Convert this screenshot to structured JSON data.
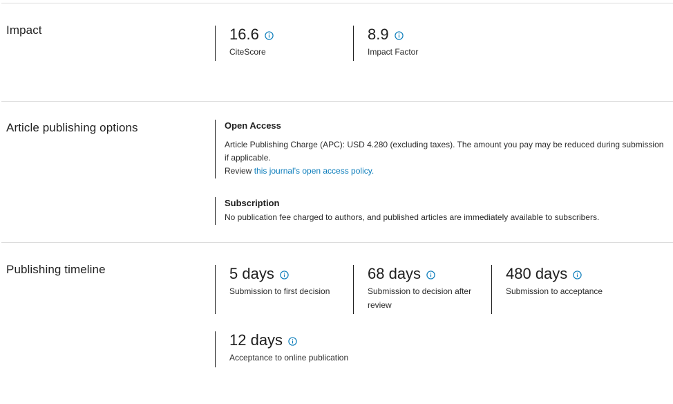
{
  "impact": {
    "title": "Impact",
    "metrics": [
      {
        "value": "16.6",
        "label": "CiteScore"
      },
      {
        "value": "8.9",
        "label": "Impact Factor"
      }
    ]
  },
  "publishing_options": {
    "title": "Article publishing options",
    "open_access": {
      "heading": "Open Access",
      "text": "Article Publishing Charge (APC): USD 4.280 (excluding taxes). The amount you pay may be reduced during submission if applicable.",
      "review_prefix": "Review ",
      "review_link": "this journal's open access policy."
    },
    "subscription": {
      "heading": "Subscription",
      "text": "No publication fee charged to authors, and published articles are immediately available to subscribers."
    }
  },
  "timeline": {
    "title": "Publishing timeline",
    "metrics": [
      {
        "value": "5 days",
        "label": "Submission to first decision"
      },
      {
        "value": "68 days",
        "label": "Submission to decision after review"
      },
      {
        "value": "480 days",
        "label": "Submission to acceptance"
      },
      {
        "value": "12 days",
        "label": "Acceptance to online publication"
      }
    ]
  },
  "icons": {
    "info": "info-circle-icon"
  },
  "colors": {
    "accent": "#0c7dbb",
    "text": "#1f1f1f",
    "divider": "#dcdcdc"
  }
}
